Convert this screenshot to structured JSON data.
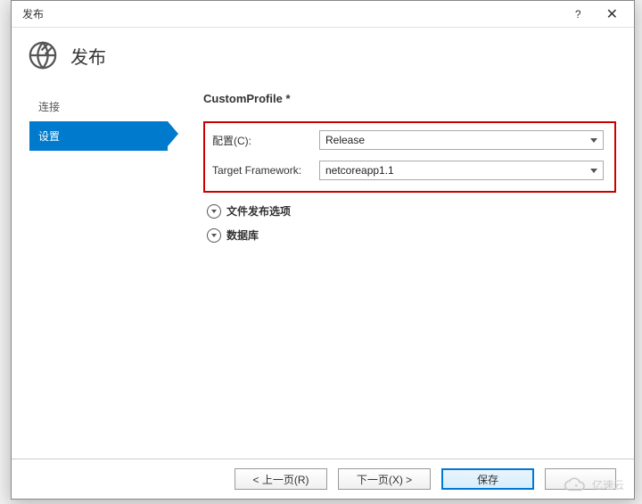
{
  "titlebar": {
    "title": "发布",
    "help": "?",
    "close": "✕"
  },
  "header": {
    "title": "发布"
  },
  "sidebar": {
    "items": [
      {
        "label": "连接",
        "active": false
      },
      {
        "label": "设置",
        "active": true
      }
    ]
  },
  "main": {
    "profile_name": "CustomProfile *",
    "fields": {
      "config_label": "配置(C):",
      "config_value": "Release",
      "framework_label": "Target Framework:",
      "framework_value": "netcoreapp1.1"
    },
    "expanders": {
      "file_options": "文件发布选项",
      "database": "数据库"
    }
  },
  "footer": {
    "prev": "< 上一页(R)",
    "next": "下一页(X) >",
    "save": "保存",
    "cancel": ""
  },
  "watermark_text": "亿速云"
}
